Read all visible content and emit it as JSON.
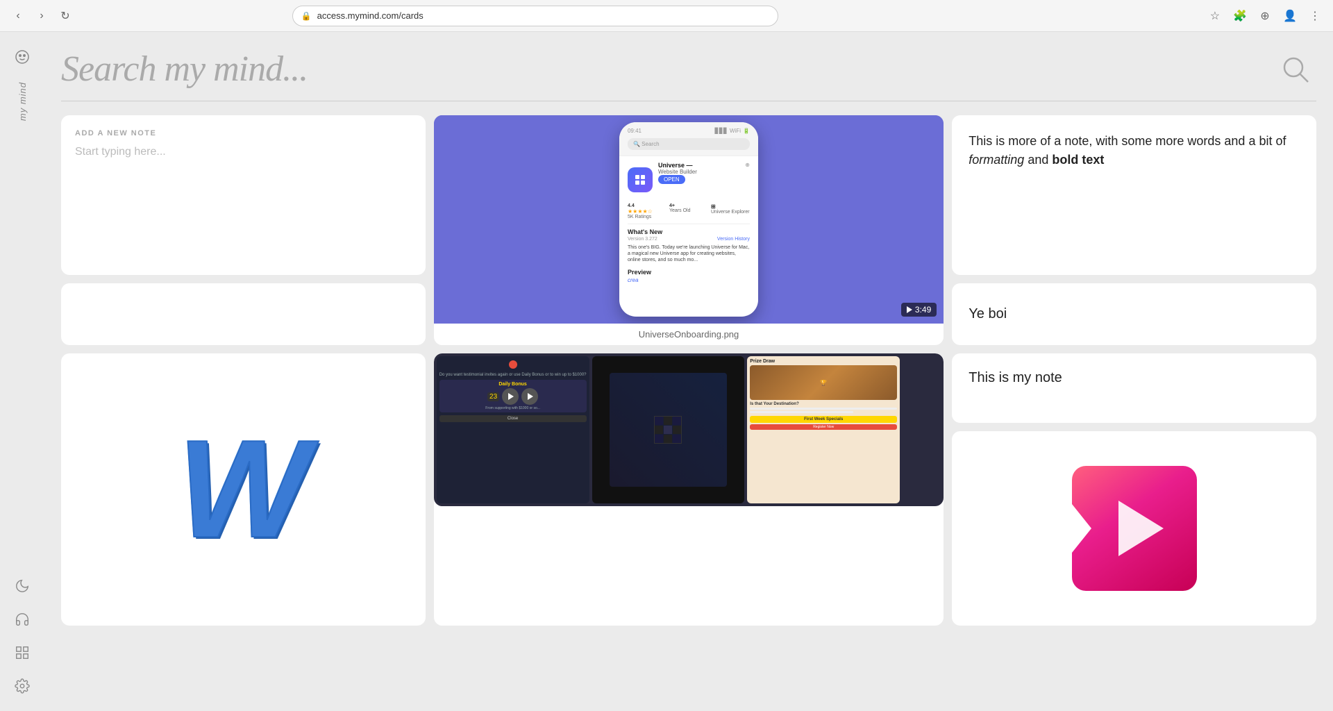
{
  "browser": {
    "url": "access.mymind.com/cards",
    "nav": {
      "back": "‹",
      "forward": "›",
      "reload": "↻"
    }
  },
  "header": {
    "title": "Search my mind...",
    "search_aria": "Search"
  },
  "sidebar": {
    "label": "my mind",
    "icons": {
      "face": "◉",
      "moon": "☽",
      "headphones": "🎧",
      "grid": "⊞",
      "settings": "⚙"
    }
  },
  "add_note": {
    "label": "ADD A NEW NOTE",
    "placeholder": "Start typing here..."
  },
  "notes": {
    "long_note": {
      "text_before_italic": "This is more of a note, with some more words and a bit of ",
      "italic_text": "formatting",
      "text_between": " and ",
      "bold_text": "bold text"
    },
    "ye_boi": "Ye boi",
    "this_is_my_note": "This is my note"
  },
  "video": {
    "filename": "UniverseOnboarding.png",
    "duration": "3:49",
    "play_icon": "▶"
  },
  "colors": {
    "video_bg": "#6b6dd6",
    "logo_blue": "#3a7bd5",
    "play_gradient_start": "#ff6b8a",
    "play_gradient_end": "#f0325a"
  }
}
